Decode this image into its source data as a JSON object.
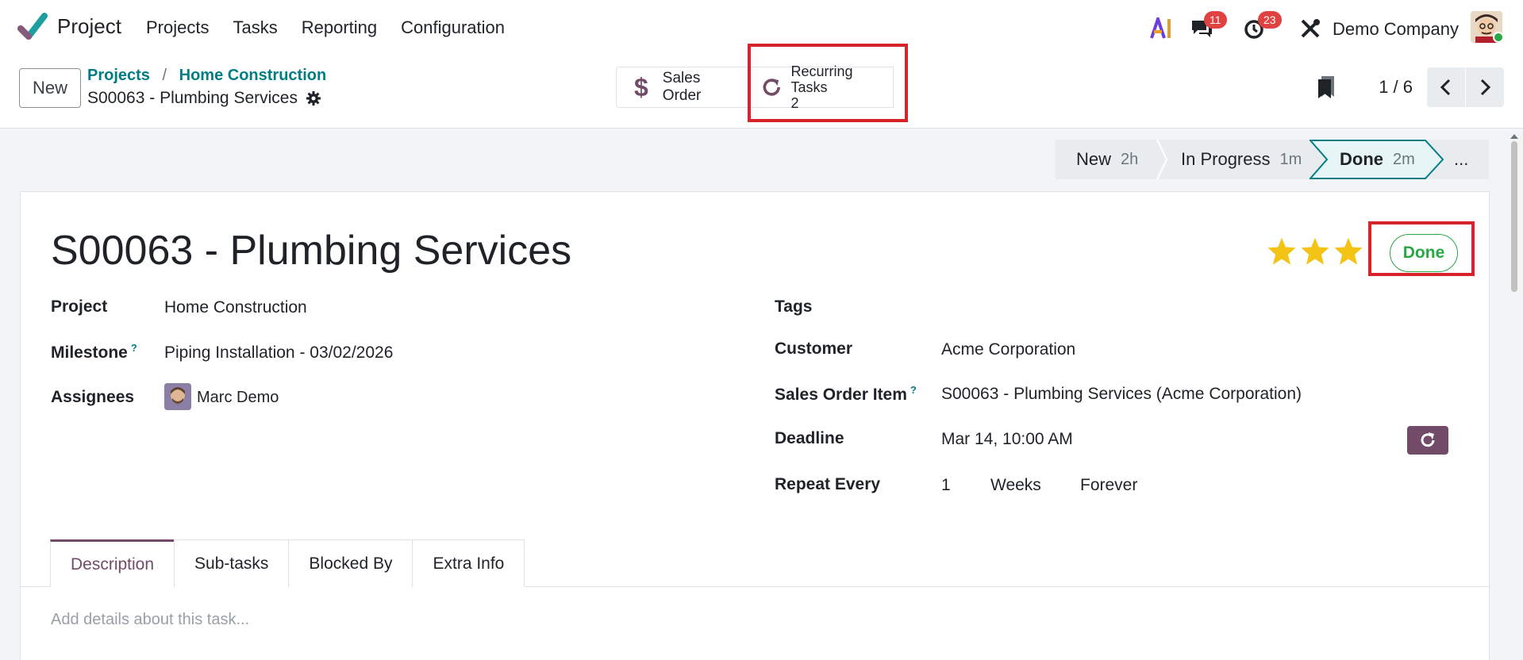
{
  "app": {
    "name": "Project",
    "logo_icon": "odoo-project-logo-icon"
  },
  "menu": [
    {
      "label": "Projects"
    },
    {
      "label": "Tasks"
    },
    {
      "label": "Reporting"
    },
    {
      "label": "Configuration"
    }
  ],
  "systray": {
    "messages_count": "11",
    "activities_count": "23",
    "company": "Demo Company",
    "badge_color": "#e04141"
  },
  "control": {
    "new_label": "New",
    "breadcrumb": [
      "Projects",
      "Home Construction"
    ],
    "breadcrumb_sep": "/",
    "record_name": "S00063 - Plumbing Services",
    "smart_buttons": {
      "sales_order_label": "Sales Order",
      "recurring_label": "Recurring Tasks",
      "recurring_count": "2"
    },
    "pager": "1 / 6"
  },
  "stages": [
    {
      "label": "New",
      "duration": "2h"
    },
    {
      "label": "In Progress",
      "duration": "1m"
    },
    {
      "label": "Done",
      "duration": "2m",
      "active": true
    },
    {
      "label": "..."
    }
  ],
  "task": {
    "title": "S00063 - Plumbing Services",
    "priority_stars": 3,
    "state": "Done",
    "left_fields": {
      "project_label": "Project",
      "project_value": "Home Construction",
      "milestone_label": "Milestone",
      "milestone_help": "?",
      "milestone_value": "Piping Installation - 03/02/2026",
      "assignees_label": "Assignees",
      "assignee_name": "Marc Demo"
    },
    "right_fields": {
      "tags_label": "Tags",
      "customer_label": "Customer",
      "customer_value": "Acme Corporation",
      "sol_label": "Sales Order Item",
      "sol_help": "?",
      "sol_value": "S00063 - Plumbing Services (Acme Corporation)",
      "deadline_label": "Deadline",
      "deadline_value": "Mar 14, 10:00 AM",
      "repeat_label": "Repeat Every",
      "repeat_interval": "1",
      "repeat_unit": "Weeks",
      "repeat_type": "Forever"
    },
    "tabs": [
      "Description",
      "Sub-tasks",
      "Blocked By",
      "Extra Info"
    ],
    "description_placeholder": "Add details about this task..."
  },
  "colors": {
    "primary": "#714b67",
    "link": "#017e84",
    "success": "#28a745",
    "star": "#f3c316",
    "highlight": "#d8232a"
  }
}
